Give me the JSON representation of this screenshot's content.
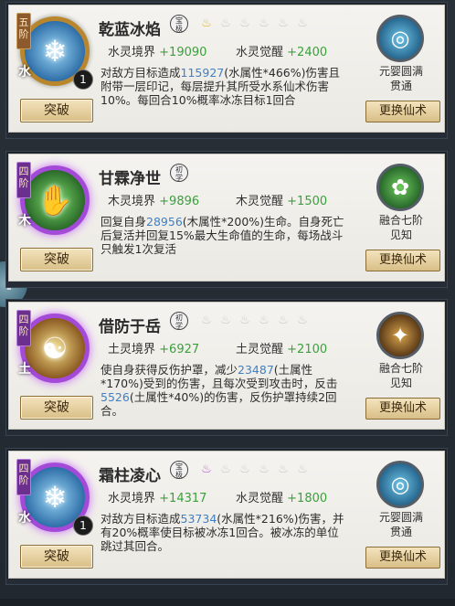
{
  "cards": [
    {
      "tier": "五阶",
      "element": "水",
      "count": "1",
      "name": "乾蓝冰焰",
      "rank": "宝\n极",
      "stars": [
        "gold",
        "grey",
        "grey",
        "grey",
        "grey",
        "grey"
      ],
      "realm_label": "水灵境界",
      "realm_value": "+19090",
      "awaken_label": "水灵觉醒",
      "awaken_value": "+2400",
      "desc_parts": [
        "对敌方目标造成",
        "115927",
        "(水属性*466%)伤害且附带一层印记，每层提升其所受水系仙术伤害10%。每回合10%概率冰冻目标1回合"
      ],
      "break_label": "突破",
      "emblem_glyph": "◎",
      "emblem_label_1": "元婴圆满",
      "emblem_label_2": "贯通",
      "swap_label": "更换仙术"
    },
    {
      "tier": "四阶",
      "element": "木",
      "count": "",
      "name": "甘霖净世",
      "rank": "初\n学",
      "stars": [],
      "realm_label": "木灵境界",
      "realm_value": "+9896",
      "awaken_label": "木灵觉醒",
      "awaken_value": "+1500",
      "desc_parts": [
        "回复自身",
        "28956",
        "(木属性*200%)生命。自身死亡后复活并回复15%最大生命值的生命，每场战斗只触发1次复活"
      ],
      "break_label": "突破",
      "emblem_glyph": "✿",
      "emblem_label_1": "融合七阶",
      "emblem_label_2": "见知",
      "swap_label": "更换仙术"
    },
    {
      "tier": "四阶",
      "element": "土",
      "count": "",
      "name": "借防于岳",
      "rank": "初\n学",
      "stars": [
        "grey",
        "grey",
        "grey",
        "grey",
        "grey",
        "grey"
      ],
      "realm_label": "土灵境界",
      "realm_value": "+6927",
      "awaken_label": "土灵觉醒",
      "awaken_value": "+2100",
      "desc_parts": [
        "使自身获得反伤护罩，减少",
        "23487",
        "(土属性*170%)受到的伤害，且每次受到攻击时，反击",
        "5526",
        "(土属性*40%)的伤害，反伤护罩持续2回合。"
      ],
      "break_label": "突破",
      "emblem_glyph": "✦",
      "emblem_label_1": "融合七阶",
      "emblem_label_2": "见知",
      "swap_label": "更换仙术"
    },
    {
      "tier": "四阶",
      "element": "水",
      "count": "1",
      "name": "霜柱凌心",
      "rank": "宝\n极",
      "stars": [
        "purple",
        "grey",
        "grey",
        "grey",
        "grey",
        "grey"
      ],
      "realm_label": "水灵境界",
      "realm_value": "+14317",
      "awaken_label": "水灵觉醒",
      "awaken_value": "+1800",
      "desc_parts": [
        "对敌方目标造成",
        "53734",
        "(水属性*216%)伤害，并有20%概率使目标被冰冻1回合。被冰冻的单位跳过其回合。"
      ],
      "break_label": "突破",
      "emblem_glyph": "◎",
      "emblem_label_1": "元婴圆满",
      "emblem_label_2": "贯通",
      "swap_label": "更换仙术"
    }
  ],
  "side_bubble": "P"
}
